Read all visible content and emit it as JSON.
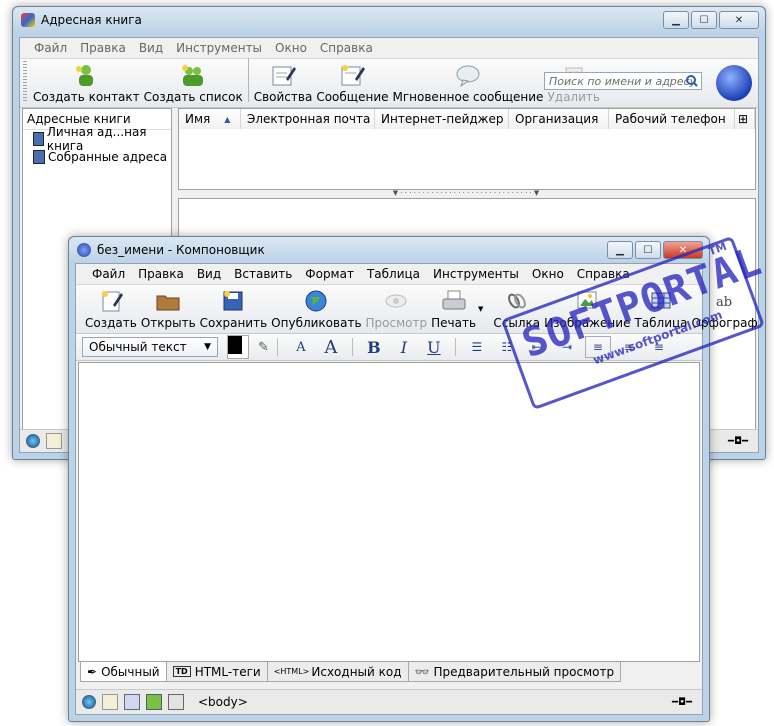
{
  "address_book": {
    "title": "Адресная книга",
    "menu": [
      "Файл",
      "Правка",
      "Вид",
      "Инструменты",
      "Окно",
      "Справка"
    ],
    "toolbar": {
      "new_contact": "Создать контакт",
      "new_list": "Создать список",
      "properties": "Свойства",
      "message": "Сообщение",
      "instant_message": "Мгновенное сообщение",
      "delete": "Удалить"
    },
    "search_placeholder": "Поиск по имени и адресу",
    "sidebar": {
      "header": "Адресные книги",
      "items": [
        "Личная ад...ная книга",
        "Собранные адреса"
      ]
    },
    "columns": [
      "Имя",
      "Электронная почта",
      "Интернет-пейджер",
      "Организация",
      "Рабочий телефон"
    ]
  },
  "composer": {
    "title": "без_имени - Компоновщик",
    "menu": [
      "Файл",
      "Правка",
      "Вид",
      "Вставить",
      "Формат",
      "Таблица",
      "Инструменты",
      "Окно",
      "Справка"
    ],
    "toolbar": {
      "new": "Создать",
      "open": "Открыть",
      "save": "Сохранить",
      "publish": "Опубликовать",
      "preview": "Просмотр",
      "print": "Печать",
      "link": "Ссылка",
      "image": "Изображение",
      "table": "Таблица",
      "spelling": "Орфограф"
    },
    "format": {
      "paragraph_style": "Обычный текст",
      "bold": "B",
      "italic": "I",
      "underline": "U",
      "smaller": "A",
      "larger": "A"
    },
    "tabs": [
      "Обычный",
      "HTML-теги",
      "Исходный код",
      "Предварительный просмотр"
    ],
    "tab_badges": [
      "TD",
      "<HTML>"
    ],
    "status_tag": "<body>"
  },
  "watermark": {
    "big": "SOFTPORTAL",
    "small": "www.softportal.com",
    "tm": "TM"
  },
  "colors": {
    "titlebar": "#bcd2e6",
    "window_bg": "#f0f0f0",
    "stamp": "#2828be"
  }
}
